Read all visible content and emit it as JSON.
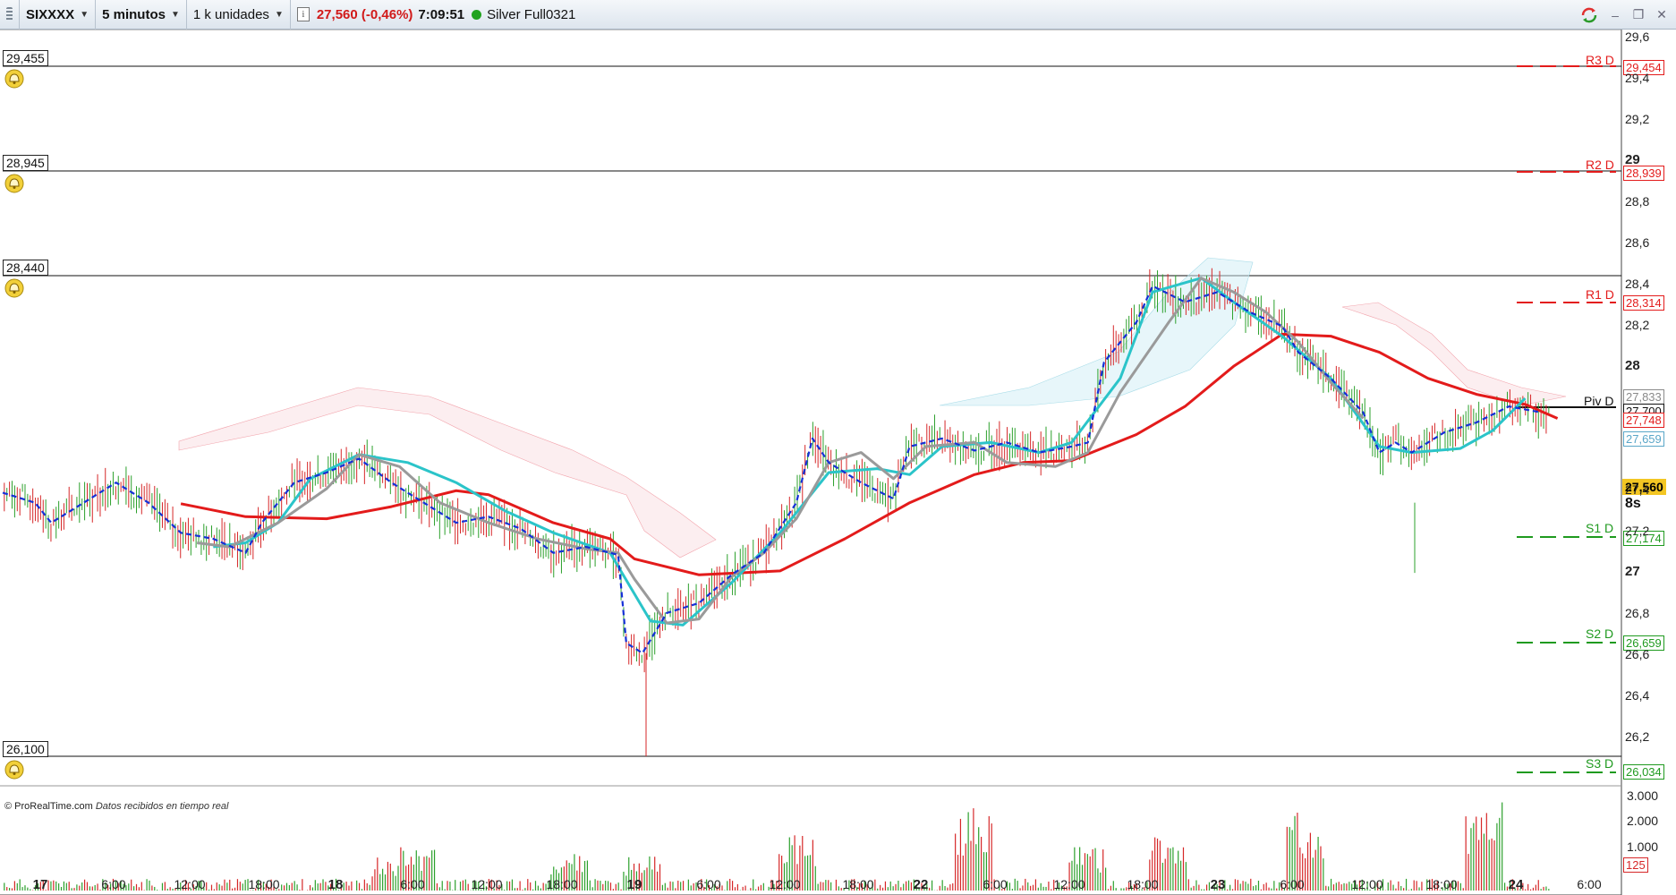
{
  "toolbar": {
    "symbol": "SIXXXX",
    "timeframe": "5 minutos",
    "units": "1 k unidades",
    "info_icon": "i",
    "price_change": "27,560 (-0,46%)",
    "time": "7:09:51",
    "instrument": "Silver Full0321",
    "status_color": "#21a31f"
  },
  "window": {
    "minimize": "–",
    "restore": "❐",
    "close": "✕"
  },
  "alert_lines": [
    {
      "value": "29,455"
    },
    {
      "value": "28,945"
    },
    {
      "value": "28,440"
    },
    {
      "value": "26,100"
    }
  ],
  "pivots": [
    {
      "label": "R3 D",
      "value": "29,454",
      "color": "#e31b1b"
    },
    {
      "label": "R2 D",
      "value": "28,939",
      "color": "#e31b1b"
    },
    {
      "label": "R1 D",
      "value": "28,314",
      "color": "#e31b1b"
    },
    {
      "label": "Piv D",
      "value": "27,700",
      "color": "#111111"
    },
    {
      "label": "S1 D",
      "value": "27,174",
      "color": "#1f9a1f"
    },
    {
      "label": "S2 D",
      "value": "26,659",
      "color": "#1f9a1f"
    },
    {
      "label": "S3 D",
      "value": "26,034",
      "color": "#1f9a1f"
    }
  ],
  "indicator_boxes": [
    {
      "value": "27,833",
      "color": "#8a8a8a"
    },
    {
      "value": "27,748",
      "color": "#e31b1b"
    },
    {
      "value": "27,659",
      "color": "#5aa6c8"
    }
  ],
  "last_price": "27,560",
  "countdown": "8s",
  "y_axis": {
    "ticks": [
      "29,6",
      "29,4",
      "29,2",
      "29",
      "28,8",
      "28,6",
      "28,4",
      "28,2",
      "28",
      "27,4",
      "27,2",
      "27",
      "26,8",
      "26,6",
      "26,4",
      "26,2"
    ],
    "bold": [
      "29",
      "28",
      "27"
    ]
  },
  "x_axis": {
    "ticks": [
      "17",
      "6:00",
      "12:00",
      "18:00",
      "18",
      "6:00",
      "12:00",
      "18:00",
      "19",
      "6:00",
      "12:00",
      "18:00",
      "22",
      "6:00",
      "12:00",
      "18:00",
      "23",
      "6:00",
      "12:00",
      "18:00",
      "24",
      "6:00"
    ],
    "bold": [
      "17",
      "18",
      "19",
      "22",
      "23",
      "24"
    ]
  },
  "volume_axis": {
    "ticks": [
      "3.000",
      "2.000",
      "1.000"
    ],
    "last": "125"
  },
  "footnote": {
    "brand": "© ProRealTime.com",
    "status": "Datos recibidos en tiempo real"
  },
  "colors": {
    "sma_slow": "#e31b1b",
    "sma_fast": "#2bc4c9",
    "lagging": "#9a9a9a",
    "tenkan": "#1530d6",
    "bull": "#2ca02c",
    "bear": "#d62728"
  },
  "chart_data": {
    "type": "line",
    "title": "",
    "ylim": [
      26.0,
      29.65
    ],
    "series": [
      {
        "name": "",
        "color": "#e31b1b",
        "points": [
          [
            0.11,
            27.295
          ],
          [
            0.15,
            27.23
          ],
          [
            0.2,
            27.22
          ],
          [
            0.24,
            27.28
          ],
          [
            0.28,
            27.36
          ],
          [
            0.3,
            27.34
          ],
          [
            0.34,
            27.2
          ],
          [
            0.375,
            27.12
          ],
          [
            0.39,
            27.02
          ],
          [
            0.43,
            26.94
          ],
          [
            0.48,
            26.96
          ],
          [
            0.52,
            27.12
          ],
          [
            0.56,
            27.3
          ],
          [
            0.6,
            27.44
          ],
          [
            0.63,
            27.5
          ],
          [
            0.66,
            27.51
          ],
          [
            0.7,
            27.64
          ],
          [
            0.73,
            27.78
          ],
          [
            0.76,
            27.98
          ],
          [
            0.79,
            28.14
          ],
          [
            0.82,
            28.13
          ],
          [
            0.85,
            28.05
          ],
          [
            0.88,
            27.92
          ],
          [
            0.91,
            27.84
          ],
          [
            0.94,
            27.79
          ],
          [
            0.96,
            27.72
          ]
        ]
      },
      {
        "name": "",
        "color": "#2bc4c9",
        "points": [
          [
            0.13,
            27.08
          ],
          [
            0.15,
            27.1
          ],
          [
            0.17,
            27.2
          ],
          [
            0.19,
            27.42
          ],
          [
            0.22,
            27.54
          ],
          [
            0.25,
            27.5
          ],
          [
            0.28,
            27.4
          ],
          [
            0.31,
            27.26
          ],
          [
            0.34,
            27.15
          ],
          [
            0.375,
            27.05
          ],
          [
            0.4,
            26.71
          ],
          [
            0.42,
            26.69
          ],
          [
            0.45,
            26.9
          ],
          [
            0.48,
            27.15
          ],
          [
            0.51,
            27.45
          ],
          [
            0.54,
            27.47
          ],
          [
            0.56,
            27.44
          ],
          [
            0.58,
            27.58
          ],
          [
            0.61,
            27.6
          ],
          [
            0.64,
            27.55
          ],
          [
            0.66,
            27.6
          ],
          [
            0.69,
            27.92
          ],
          [
            0.71,
            28.35
          ],
          [
            0.74,
            28.42
          ],
          [
            0.76,
            28.3
          ],
          [
            0.79,
            28.13
          ],
          [
            0.82,
            27.92
          ],
          [
            0.85,
            27.58
          ],
          [
            0.87,
            27.55
          ],
          [
            0.9,
            27.57
          ],
          [
            0.92,
            27.66
          ],
          [
            0.94,
            27.82
          ]
        ]
      },
      {
        "name": "",
        "color": "#9a9a9a",
        "points": [
          [
            0.12,
            27.1
          ],
          [
            0.14,
            27.08
          ],
          [
            0.17,
            27.2
          ],
          [
            0.2,
            27.37
          ],
          [
            0.22,
            27.54
          ],
          [
            0.245,
            27.48
          ],
          [
            0.27,
            27.3
          ],
          [
            0.3,
            27.2
          ],
          [
            0.33,
            27.12
          ],
          [
            0.36,
            27.07
          ],
          [
            0.38,
            27.05
          ],
          [
            0.39,
            26.92
          ],
          [
            0.41,
            26.7
          ],
          [
            0.43,
            26.72
          ],
          [
            0.45,
            26.93
          ],
          [
            0.47,
            27.05
          ],
          [
            0.49,
            27.22
          ],
          [
            0.51,
            27.5
          ],
          [
            0.53,
            27.55
          ],
          [
            0.55,
            27.42
          ],
          [
            0.57,
            27.58
          ],
          [
            0.6,
            27.6
          ],
          [
            0.62,
            27.5
          ],
          [
            0.65,
            27.48
          ],
          [
            0.67,
            27.55
          ],
          [
            0.69,
            27.85
          ],
          [
            0.72,
            28.2
          ],
          [
            0.74,
            28.42
          ],
          [
            0.76,
            28.35
          ],
          [
            0.78,
            28.25
          ],
          [
            0.8,
            28.1
          ],
          [
            0.82,
            27.9
          ],
          [
            0.84,
            27.72
          ]
        ]
      },
      {
        "name": "",
        "color": "#1530d6",
        "dash": true,
        "points": [
          [
            0.0,
            27.35
          ],
          [
            0.02,
            27.3
          ],
          [
            0.03,
            27.2
          ],
          [
            0.05,
            27.3
          ],
          [
            0.07,
            27.4
          ],
          [
            0.09,
            27.3
          ],
          [
            0.11,
            27.15
          ],
          [
            0.13,
            27.12
          ],
          [
            0.15,
            27.05
          ],
          [
            0.16,
            27.2
          ],
          [
            0.18,
            27.4
          ],
          [
            0.2,
            27.45
          ],
          [
            0.22,
            27.52
          ],
          [
            0.24,
            27.4
          ],
          [
            0.26,
            27.3
          ],
          [
            0.28,
            27.2
          ],
          [
            0.3,
            27.23
          ],
          [
            0.32,
            27.17
          ],
          [
            0.34,
            27.05
          ],
          [
            0.36,
            27.08
          ],
          [
            0.38,
            27.04
          ],
          [
            0.385,
            26.6
          ],
          [
            0.395,
            26.55
          ],
          [
            0.41,
            26.75
          ],
          [
            0.43,
            26.8
          ],
          [
            0.45,
            26.94
          ],
          [
            0.47,
            27.05
          ],
          [
            0.49,
            27.3
          ],
          [
            0.5,
            27.62
          ],
          [
            0.51,
            27.5
          ],
          [
            0.53,
            27.4
          ],
          [
            0.55,
            27.32
          ],
          [
            0.56,
            27.58
          ],
          [
            0.58,
            27.62
          ],
          [
            0.6,
            27.56
          ],
          [
            0.62,
            27.6
          ],
          [
            0.64,
            27.55
          ],
          [
            0.66,
            27.58
          ],
          [
            0.67,
            27.6
          ],
          [
            0.68,
            28.0
          ],
          [
            0.7,
            28.2
          ],
          [
            0.71,
            28.38
          ],
          [
            0.73,
            28.3
          ],
          [
            0.75,
            28.35
          ],
          [
            0.77,
            28.25
          ],
          [
            0.79,
            28.18
          ],
          [
            0.8,
            28.05
          ],
          [
            0.82,
            27.92
          ],
          [
            0.84,
            27.75
          ],
          [
            0.85,
            27.55
          ],
          [
            0.86,
            27.6
          ],
          [
            0.87,
            27.55
          ],
          [
            0.89,
            27.65
          ],
          [
            0.91,
            27.7
          ],
          [
            0.93,
            27.78
          ],
          [
            0.95,
            27.75
          ]
        ]
      }
    ]
  }
}
